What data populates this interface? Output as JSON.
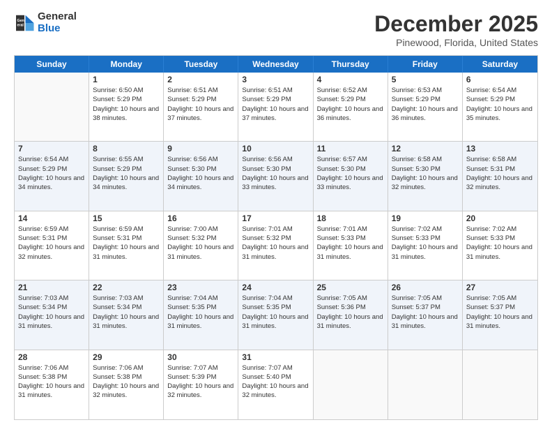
{
  "logo": {
    "line1": "General",
    "line2": "Blue"
  },
  "title": "December 2025",
  "subtitle": "Pinewood, Florida, United States",
  "header_days": [
    "Sunday",
    "Monday",
    "Tuesday",
    "Wednesday",
    "Thursday",
    "Friday",
    "Saturday"
  ],
  "weeks": [
    [
      {
        "day": "",
        "sunrise": "",
        "sunset": "",
        "daylight": "",
        "empty": true
      },
      {
        "day": "1",
        "sunrise": "Sunrise: 6:50 AM",
        "sunset": "Sunset: 5:29 PM",
        "daylight": "Daylight: 10 hours and 38 minutes.",
        "empty": false
      },
      {
        "day": "2",
        "sunrise": "Sunrise: 6:51 AM",
        "sunset": "Sunset: 5:29 PM",
        "daylight": "Daylight: 10 hours and 37 minutes.",
        "empty": false
      },
      {
        "day": "3",
        "sunrise": "Sunrise: 6:51 AM",
        "sunset": "Sunset: 5:29 PM",
        "daylight": "Daylight: 10 hours and 37 minutes.",
        "empty": false
      },
      {
        "day": "4",
        "sunrise": "Sunrise: 6:52 AM",
        "sunset": "Sunset: 5:29 PM",
        "daylight": "Daylight: 10 hours and 36 minutes.",
        "empty": false
      },
      {
        "day": "5",
        "sunrise": "Sunrise: 6:53 AM",
        "sunset": "Sunset: 5:29 PM",
        "daylight": "Daylight: 10 hours and 36 minutes.",
        "empty": false
      },
      {
        "day": "6",
        "sunrise": "Sunrise: 6:54 AM",
        "sunset": "Sunset: 5:29 PM",
        "daylight": "Daylight: 10 hours and 35 minutes.",
        "empty": false
      }
    ],
    [
      {
        "day": "7",
        "sunrise": "Sunrise: 6:54 AM",
        "sunset": "Sunset: 5:29 PM",
        "daylight": "Daylight: 10 hours and 34 minutes.",
        "empty": false
      },
      {
        "day": "8",
        "sunrise": "Sunrise: 6:55 AM",
        "sunset": "Sunset: 5:29 PM",
        "daylight": "Daylight: 10 hours and 34 minutes.",
        "empty": false
      },
      {
        "day": "9",
        "sunrise": "Sunrise: 6:56 AM",
        "sunset": "Sunset: 5:30 PM",
        "daylight": "Daylight: 10 hours and 34 minutes.",
        "empty": false
      },
      {
        "day": "10",
        "sunrise": "Sunrise: 6:56 AM",
        "sunset": "Sunset: 5:30 PM",
        "daylight": "Daylight: 10 hours and 33 minutes.",
        "empty": false
      },
      {
        "day": "11",
        "sunrise": "Sunrise: 6:57 AM",
        "sunset": "Sunset: 5:30 PM",
        "daylight": "Daylight: 10 hours and 33 minutes.",
        "empty": false
      },
      {
        "day": "12",
        "sunrise": "Sunrise: 6:58 AM",
        "sunset": "Sunset: 5:30 PM",
        "daylight": "Daylight: 10 hours and 32 minutes.",
        "empty": false
      },
      {
        "day": "13",
        "sunrise": "Sunrise: 6:58 AM",
        "sunset": "Sunset: 5:31 PM",
        "daylight": "Daylight: 10 hours and 32 minutes.",
        "empty": false
      }
    ],
    [
      {
        "day": "14",
        "sunrise": "Sunrise: 6:59 AM",
        "sunset": "Sunset: 5:31 PM",
        "daylight": "Daylight: 10 hours and 32 minutes.",
        "empty": false
      },
      {
        "day": "15",
        "sunrise": "Sunrise: 6:59 AM",
        "sunset": "Sunset: 5:31 PM",
        "daylight": "Daylight: 10 hours and 31 minutes.",
        "empty": false
      },
      {
        "day": "16",
        "sunrise": "Sunrise: 7:00 AM",
        "sunset": "Sunset: 5:32 PM",
        "daylight": "Daylight: 10 hours and 31 minutes.",
        "empty": false
      },
      {
        "day": "17",
        "sunrise": "Sunrise: 7:01 AM",
        "sunset": "Sunset: 5:32 PM",
        "daylight": "Daylight: 10 hours and 31 minutes.",
        "empty": false
      },
      {
        "day": "18",
        "sunrise": "Sunrise: 7:01 AM",
        "sunset": "Sunset: 5:33 PM",
        "daylight": "Daylight: 10 hours and 31 minutes.",
        "empty": false
      },
      {
        "day": "19",
        "sunrise": "Sunrise: 7:02 AM",
        "sunset": "Sunset: 5:33 PM",
        "daylight": "Daylight: 10 hours and 31 minutes.",
        "empty": false
      },
      {
        "day": "20",
        "sunrise": "Sunrise: 7:02 AM",
        "sunset": "Sunset: 5:33 PM",
        "daylight": "Daylight: 10 hours and 31 minutes.",
        "empty": false
      }
    ],
    [
      {
        "day": "21",
        "sunrise": "Sunrise: 7:03 AM",
        "sunset": "Sunset: 5:34 PM",
        "daylight": "Daylight: 10 hours and 31 minutes.",
        "empty": false
      },
      {
        "day": "22",
        "sunrise": "Sunrise: 7:03 AM",
        "sunset": "Sunset: 5:34 PM",
        "daylight": "Daylight: 10 hours and 31 minutes.",
        "empty": false
      },
      {
        "day": "23",
        "sunrise": "Sunrise: 7:04 AM",
        "sunset": "Sunset: 5:35 PM",
        "daylight": "Daylight: 10 hours and 31 minutes.",
        "empty": false
      },
      {
        "day": "24",
        "sunrise": "Sunrise: 7:04 AM",
        "sunset": "Sunset: 5:35 PM",
        "daylight": "Daylight: 10 hours and 31 minutes.",
        "empty": false
      },
      {
        "day": "25",
        "sunrise": "Sunrise: 7:05 AM",
        "sunset": "Sunset: 5:36 PM",
        "daylight": "Daylight: 10 hours and 31 minutes.",
        "empty": false
      },
      {
        "day": "26",
        "sunrise": "Sunrise: 7:05 AM",
        "sunset": "Sunset: 5:37 PM",
        "daylight": "Daylight: 10 hours and 31 minutes.",
        "empty": false
      },
      {
        "day": "27",
        "sunrise": "Sunrise: 7:05 AM",
        "sunset": "Sunset: 5:37 PM",
        "daylight": "Daylight: 10 hours and 31 minutes.",
        "empty": false
      }
    ],
    [
      {
        "day": "28",
        "sunrise": "Sunrise: 7:06 AM",
        "sunset": "Sunset: 5:38 PM",
        "daylight": "Daylight: 10 hours and 31 minutes.",
        "empty": false
      },
      {
        "day": "29",
        "sunrise": "Sunrise: 7:06 AM",
        "sunset": "Sunset: 5:38 PM",
        "daylight": "Daylight: 10 hours and 32 minutes.",
        "empty": false
      },
      {
        "day": "30",
        "sunrise": "Sunrise: 7:07 AM",
        "sunset": "Sunset: 5:39 PM",
        "daylight": "Daylight: 10 hours and 32 minutes.",
        "empty": false
      },
      {
        "day": "31",
        "sunrise": "Sunrise: 7:07 AM",
        "sunset": "Sunset: 5:40 PM",
        "daylight": "Daylight: 10 hours and 32 minutes.",
        "empty": false
      },
      {
        "day": "",
        "sunrise": "",
        "sunset": "",
        "daylight": "",
        "empty": true
      },
      {
        "day": "",
        "sunrise": "",
        "sunset": "",
        "daylight": "",
        "empty": true
      },
      {
        "day": "",
        "sunrise": "",
        "sunset": "",
        "daylight": "",
        "empty": true
      }
    ]
  ]
}
